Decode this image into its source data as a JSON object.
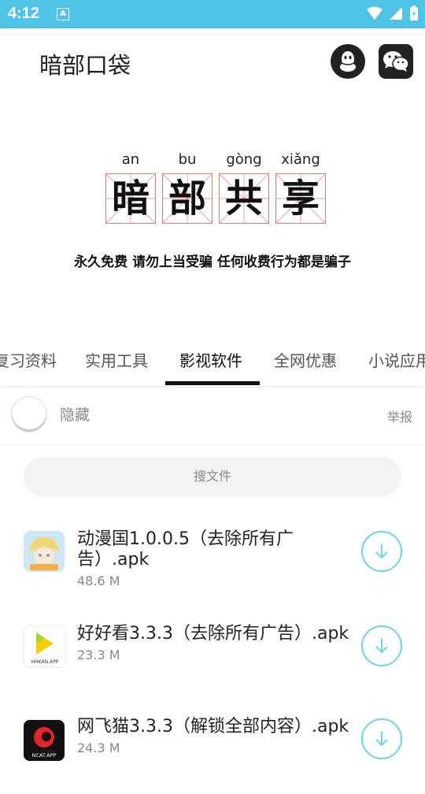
{
  "status_bar": {
    "time": "4:12",
    "notif_letter": "A"
  },
  "app_bar": {
    "title": "暗部口袋"
  },
  "banner": {
    "characters": [
      {
        "pinyin": "an",
        "char": "暗"
      },
      {
        "pinyin": "bu",
        "char": "部"
      },
      {
        "pinyin": "gòng",
        "char": "共"
      },
      {
        "pinyin": "xiǎng",
        "char": "享"
      }
    ],
    "slogan": "永久免费 请勿上当受骗 任何收费行为都是骗子"
  },
  "tabs": [
    "复习资料",
    "实用工具",
    "影视软件",
    "全网优惠",
    "小说应用"
  ],
  "active_tab": "影视软件",
  "poster": {
    "name": "隐藏",
    "report": "举报"
  },
  "search": {
    "placeholder": "搜文件"
  },
  "files": [
    {
      "name": "动漫国1.0.0.5（去除所有广告）.apk",
      "size": "48.6 M",
      "icon": "dongman-app-icon",
      "icon_text": "动漫共和国"
    },
    {
      "name": "好好看3.3.3（去除所有广告）.apk",
      "size": "23.3 M",
      "icon": "haohaokan-app-icon",
      "icon_text": "HHKAN.APP"
    },
    {
      "name": "网飞猫3.3.3（解锁全部内容）.apk",
      "size": "24.3 M",
      "icon": "ncat-app-icon",
      "icon_text": "NCAT.APP"
    }
  ],
  "colors": {
    "status_bar": "#4fc3e6",
    "accent": "#6cd0f0",
    "grid_red": "#e07a7a"
  }
}
